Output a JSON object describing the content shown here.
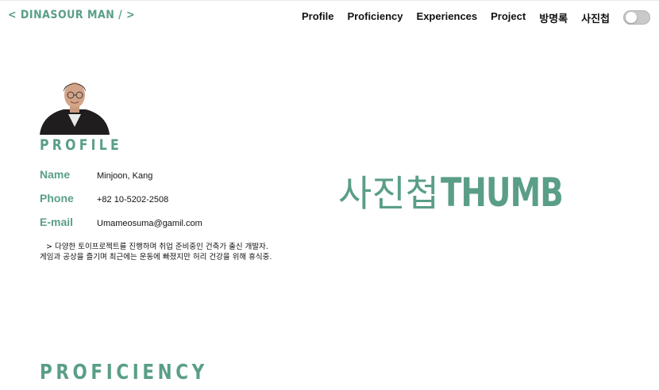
{
  "header": {
    "brand": "< DINASOUR MAN / >",
    "nav": [
      "Profile",
      "Proficiency",
      "Experiences",
      "Project",
      "방명록",
      "사진첩"
    ],
    "theme_toggle": {
      "state": "off"
    }
  },
  "profile": {
    "section_title": "PROFILE",
    "avatar": "profile-photo",
    "fields": [
      {
        "label": "Name",
        "value": "Minjoon, Kang"
      },
      {
        "label": "Phone",
        "value": "+82 10-5202-2508"
      },
      {
        "label": "E-mail",
        "value": "Umameosuma@gamil.com"
      }
    ],
    "bio_line1": "> 다양한 토이프로젝트를 진행하며 취업 준비중인 건축가 출신 개발자.",
    "bio_line2": "게임과 공상을 즐기며 최근에는 운동에 빠졌지만 허리 건강을 위해 휴식중."
  },
  "hero": {
    "korean": "사진첩",
    "english": "THUMB"
  },
  "proficiency": {
    "section_title": "PROFICIENCY"
  },
  "colors": {
    "accent": "#5a9e88",
    "text": "#111111",
    "toggle_track": "#c9c9c9"
  }
}
